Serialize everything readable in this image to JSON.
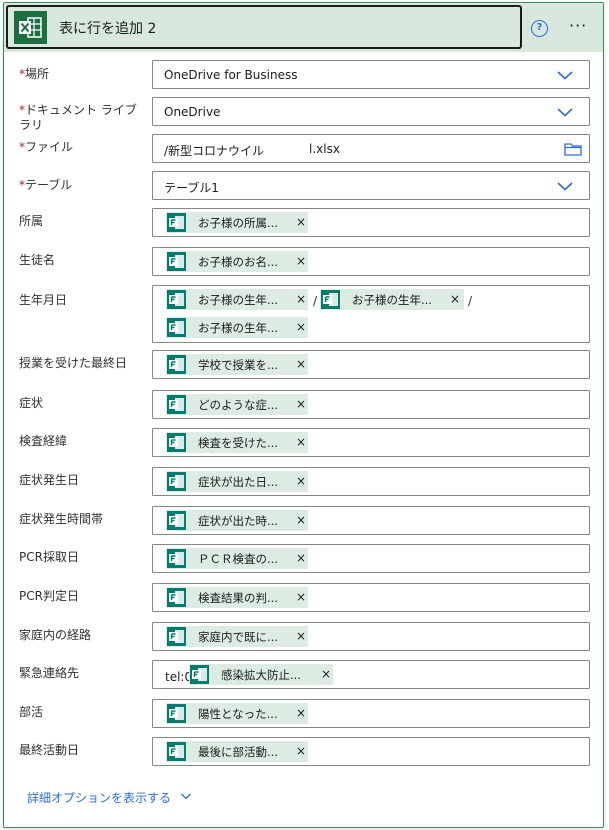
{
  "header": {
    "title": "表に行を追加 2",
    "help_symbol": "?",
    "more_symbol": "···",
    "icon": "excel-icon"
  },
  "required_mark": "*",
  "fields": {
    "location": {
      "label": "場所",
      "value": "OneDrive for Business"
    },
    "library": {
      "label": "ドキュメント ライブラリ",
      "value": "OneDrive"
    },
    "file": {
      "label": "ファイル",
      "value": "/新型コロナウイル",
      "value_suffix": "l.xlsx"
    },
    "table": {
      "label": "テーブル",
      "value": "テーブル1"
    },
    "affiliation": {
      "label": "所属",
      "token": "お子様の所属..."
    },
    "student_name": {
      "label": "生徒名",
      "token": "お子様のお名..."
    },
    "birthdate": {
      "label": "生年月日",
      "tokens": [
        "お子様の生年...",
        "お子様の生年...",
        "お子様の生年..."
      ],
      "separator": "/"
    },
    "last_class": {
      "label": "授業を受けた最終日",
      "token": "学校で授業を..."
    },
    "symptoms": {
      "label": "症状",
      "token": "どのような症..."
    },
    "test_history": {
      "label": "検査経緯",
      "token": "検査を受けた..."
    },
    "onset_date": {
      "label": "症状発生日",
      "token": "症状が出た日..."
    },
    "onset_time": {
      "label": "症状発生時間帯",
      "token": "症状が出た時..."
    },
    "pcr_date": {
      "label": "PCR採取日",
      "token": "ＰＣＲ検査の..."
    },
    "pcr_result_date": {
      "label": "PCR判定日",
      "token": "検査結果の判..."
    },
    "home_route": {
      "label": "家庭内の経路",
      "token": "家庭内で既に..."
    },
    "emergency_contact": {
      "label": "緊急連絡先",
      "prefix": "tel:0",
      "token": "感染拡大防止..."
    },
    "club": {
      "label": "部活",
      "token": "陽性となった..."
    },
    "last_activity": {
      "label": "最終活動日",
      "token": "最後に部活動..."
    }
  },
  "token_remove_symbol": "×",
  "advanced_options": {
    "label": "詳細オプションを表示する"
  },
  "colors": {
    "accent": "#2b6ed9",
    "header_bg": "#d8e8dd",
    "token_bg": "#dcece3",
    "forms_icon": "#037c6e",
    "excel_icon": "#1d6f42",
    "required": "#a4262c"
  }
}
